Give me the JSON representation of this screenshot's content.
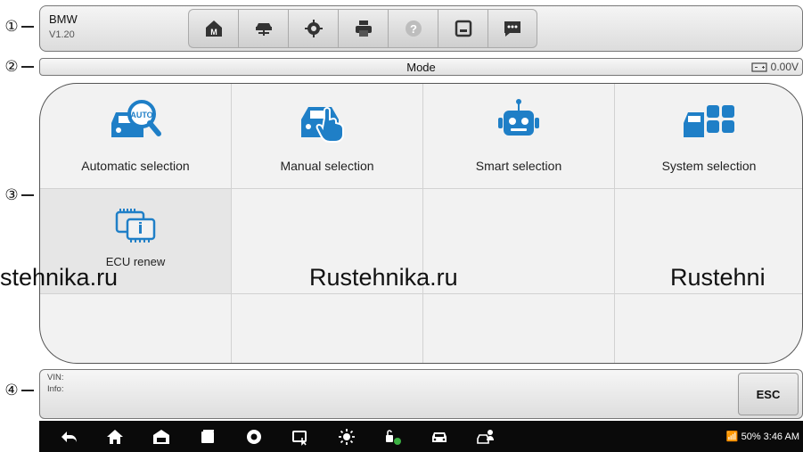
{
  "callouts": [
    "①",
    "②",
    "③",
    "④"
  ],
  "header": {
    "app_name": "BMW",
    "version": "V1.20",
    "toolbar": [
      {
        "icon": "home-icon"
      },
      {
        "icon": "vehicle-lift-icon"
      },
      {
        "icon": "settings-icon"
      },
      {
        "icon": "print-icon"
      },
      {
        "icon": "help-icon"
      },
      {
        "icon": "save-icon"
      },
      {
        "icon": "data-logging-icon"
      }
    ]
  },
  "status": {
    "title": "Mode",
    "voltage": "0.00V",
    "battery_icon": "battery-icon"
  },
  "modes": [
    {
      "label": "Automatic selection",
      "icon": "car-auto-search-icon"
    },
    {
      "label": "Manual selection",
      "icon": "car-hand-icon"
    },
    {
      "label": "Smart selection",
      "icon": "robot-icon"
    },
    {
      "label": "System selection",
      "icon": "car-grid-icon"
    },
    {
      "label": "ECU renew",
      "icon": "ecu-chip-icon"
    }
  ],
  "watermarks": [
    "stehnika.ru",
    "Rustehnika.ru",
    "Rustehni"
  ],
  "info": {
    "vin_label": "VIN:",
    "info_label": "Info:",
    "esc_label": "ESC"
  },
  "system": {
    "battery": "50%",
    "time": "3:46 AM"
  },
  "colors": {
    "accent": "#1f7fc7",
    "navbar": "#0a0a0a"
  }
}
